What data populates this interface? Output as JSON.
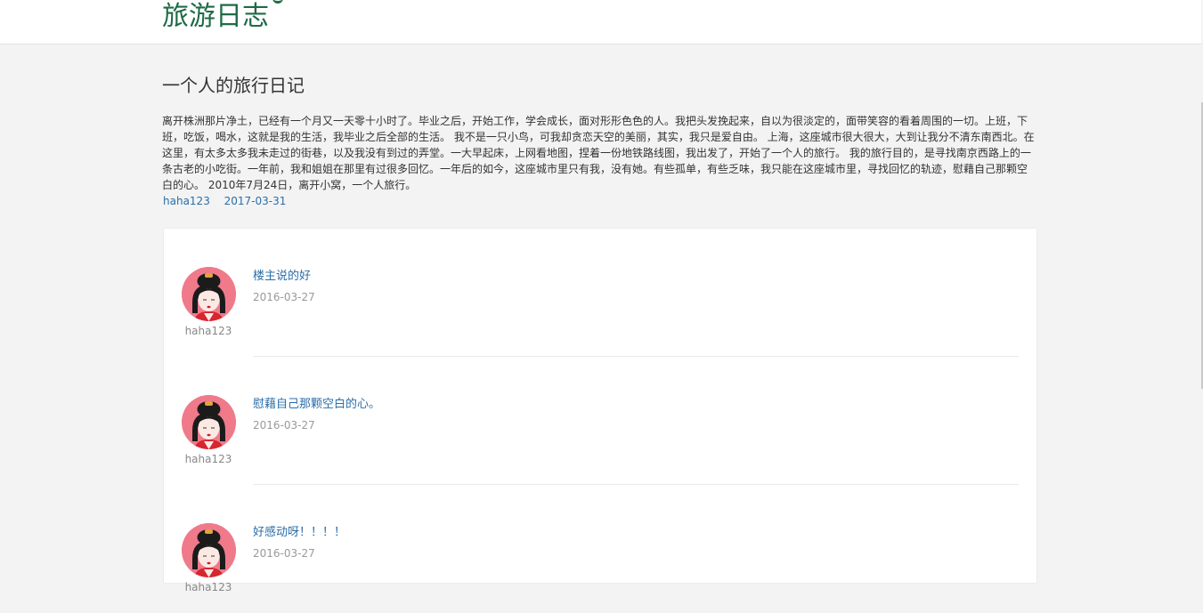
{
  "header": {
    "site_title": "旅游日志"
  },
  "diary": {
    "title": "一个人的旅行日记",
    "body": "离开株洲那片净土，已经有一个月又一天零十小时了。毕业之后，开始工作，学会成长，面对形形色色的人。我把头发挽起来，自以为很淡定的，面带笑容的看着周围的一切。上班，下班，吃饭，喝水，这就是我的生活，我毕业之后全部的生活。 我不是一只小鸟，可我却贪恋天空的美丽，其实，我只是爱自由。 上海，这座城市很大很大，大到让我分不清东南西北。在这里，有太多太多我未走过的街巷，以及我没有到过的弄堂。一大早起床，上网看地图，捏着一份地铁路线图，我出发了，开始了一个人的旅行。 我的旅行目的，是寻找南京西路上的一条古老的小吃街。一年前，我和姐姐在那里有过很多回忆。一年后的如今，这座城市里只有我，没有她。有些孤单，有些乏味，我只能在这座城市里，寻找回忆的轨迹，慰藉自己那颗空白的心。 2010年7月24日，离开小窝，一个人旅行。",
    "author": "haha123",
    "date": "2017-03-31"
  },
  "comments": [
    {
      "text": "楼主说的好",
      "date": "2016-03-27",
      "user": "haha123"
    },
    {
      "text": "慰藉自己那颗空白的心。",
      "date": "2016-03-27",
      "user": "haha123"
    },
    {
      "text": "好感动呀！！！！",
      "date": "2016-03-27",
      "user": "haha123"
    }
  ],
  "colors": {
    "accent_green": "#1e6b46",
    "link_blue": "#2a6ea8",
    "avatar_pink": "#f07a8a"
  },
  "icons": {
    "avatar": "geisha-avatar-icon"
  }
}
